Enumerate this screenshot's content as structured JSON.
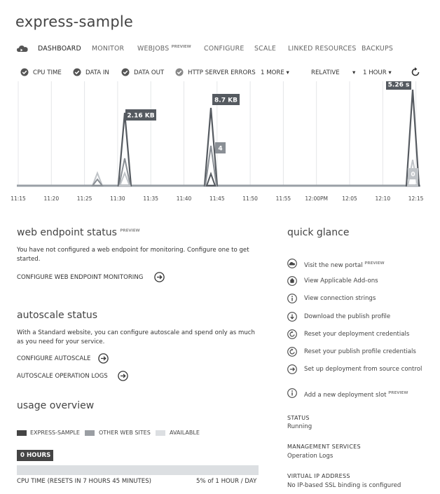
{
  "app": {
    "title": "express-sample"
  },
  "tabs": [
    {
      "label": "DASHBOARD",
      "active": true
    },
    {
      "label": "MONITOR"
    },
    {
      "label": "WEBJOBS",
      "badge": "PREVIEW"
    },
    {
      "label": "CONFIGURE"
    },
    {
      "label": "SCALE"
    },
    {
      "label": "LINKED RESOURCES"
    },
    {
      "label": "BACKUPS"
    }
  ],
  "metrics": [
    {
      "label": "CPU TIME",
      "checked": true
    },
    {
      "label": "DATA IN",
      "checked": true
    },
    {
      "label": "DATA OUT",
      "checked": true
    },
    {
      "label": "HTTP SERVER ERRORS",
      "checked": true
    }
  ],
  "chart_controls": {
    "more": "1 MORE",
    "mode": "RELATIVE",
    "range": "1 HOUR"
  },
  "chart_data": {
    "type": "line",
    "x": [
      "11:15",
      "11:20",
      "11:25",
      "11:30",
      "11:35",
      "11:40",
      "11:45",
      "11:50",
      "11:55",
      "12:00PM",
      "12:05",
      "12:10",
      "12:15"
    ],
    "xlabel": "",
    "ylabel": "",
    "annotations": [
      "2.16 KB",
      "8.7 KB",
      "4",
      "5.26 s",
      "0"
    ],
    "colors": {
      "dark": "#555a60",
      "mid": "#8a8f95",
      "light": "#c0c4c8"
    }
  },
  "web_endpoint": {
    "title": "web endpoint status",
    "badge": "PREVIEW",
    "text": "You have not configured a web endpoint for monitoring. Configure one to get started.",
    "link": "CONFIGURE WEB ENDPOINT MONITORING"
  },
  "autoscale": {
    "title": "autoscale status",
    "text": "With a Standard website, you can configure autoscale and spend only as much as you need for your service.",
    "link1": "CONFIGURE AUTOSCALE",
    "link2": "AUTOSCALE OPERATION LOGS"
  },
  "usage": {
    "title": "usage overview",
    "legend": [
      "EXPRESS-SAMPLE",
      "OTHER WEB SITES",
      "AVAILABLE"
    ],
    "bar_label": "0 HOURS",
    "cpu_label": "CPU TIME (RESETS IN 7 HOURS 45 MINUTES)",
    "cpu_value": "5% of 1 HOUR / DAY"
  },
  "quick_glance": {
    "title": "quick glance",
    "items": [
      {
        "label": "Visit the new portal",
        "badge": "PREVIEW",
        "icon": "cloud-icon"
      },
      {
        "label": "View Applicable Add-ons",
        "icon": "addon-icon"
      },
      {
        "label": "View connection strings",
        "icon": "info-icon"
      },
      {
        "label": "Download the publish profile",
        "icon": "download-icon"
      },
      {
        "label": "Reset your deployment credentials",
        "icon": "reset-icon"
      },
      {
        "label": "Reset your publish profile credentials",
        "icon": "reset-icon"
      },
      {
        "label": "Set up deployment from source control",
        "icon": "arrow-icon"
      },
      {
        "label": "Add a new deployment slot",
        "badge": "PREVIEW",
        "icon": "info-icon"
      }
    ],
    "status_label": "STATUS",
    "status_value": "Running",
    "mgmt_label": "MANAGEMENT SERVICES",
    "mgmt_value": "Operation Logs",
    "vip_label": "VIRTUAL IP ADDRESS",
    "vip_value": "No IP-based SSL binding is configured"
  }
}
